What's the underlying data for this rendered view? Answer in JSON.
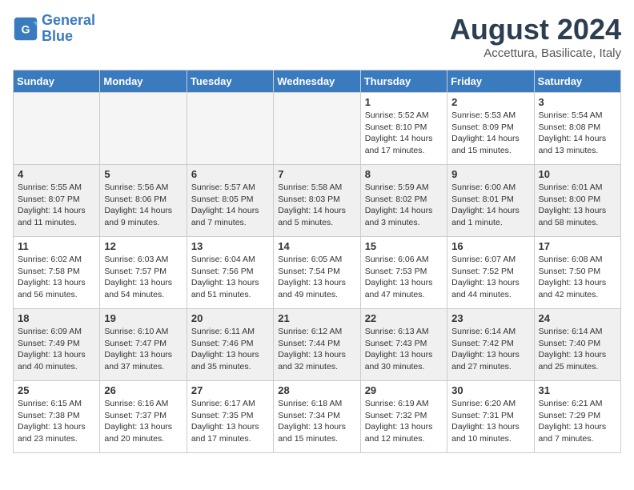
{
  "header": {
    "logo_line1": "General",
    "logo_line2": "Blue",
    "month_year": "August 2024",
    "location": "Accettura, Basilicate, Italy"
  },
  "weekdays": [
    "Sunday",
    "Monday",
    "Tuesday",
    "Wednesday",
    "Thursday",
    "Friday",
    "Saturday"
  ],
  "weeks": [
    [
      {
        "day": "",
        "info": ""
      },
      {
        "day": "",
        "info": ""
      },
      {
        "day": "",
        "info": ""
      },
      {
        "day": "",
        "info": ""
      },
      {
        "day": "1",
        "info": "Sunrise: 5:52 AM\nSunset: 8:10 PM\nDaylight: 14 hours\nand 17 minutes."
      },
      {
        "day": "2",
        "info": "Sunrise: 5:53 AM\nSunset: 8:09 PM\nDaylight: 14 hours\nand 15 minutes."
      },
      {
        "day": "3",
        "info": "Sunrise: 5:54 AM\nSunset: 8:08 PM\nDaylight: 14 hours\nand 13 minutes."
      }
    ],
    [
      {
        "day": "4",
        "info": "Sunrise: 5:55 AM\nSunset: 8:07 PM\nDaylight: 14 hours\nand 11 minutes."
      },
      {
        "day": "5",
        "info": "Sunrise: 5:56 AM\nSunset: 8:06 PM\nDaylight: 14 hours\nand 9 minutes."
      },
      {
        "day": "6",
        "info": "Sunrise: 5:57 AM\nSunset: 8:05 PM\nDaylight: 14 hours\nand 7 minutes."
      },
      {
        "day": "7",
        "info": "Sunrise: 5:58 AM\nSunset: 8:03 PM\nDaylight: 14 hours\nand 5 minutes."
      },
      {
        "day": "8",
        "info": "Sunrise: 5:59 AM\nSunset: 8:02 PM\nDaylight: 14 hours\nand 3 minutes."
      },
      {
        "day": "9",
        "info": "Sunrise: 6:00 AM\nSunset: 8:01 PM\nDaylight: 14 hours\nand 1 minute."
      },
      {
        "day": "10",
        "info": "Sunrise: 6:01 AM\nSunset: 8:00 PM\nDaylight: 13 hours\nand 58 minutes."
      }
    ],
    [
      {
        "day": "11",
        "info": "Sunrise: 6:02 AM\nSunset: 7:58 PM\nDaylight: 13 hours\nand 56 minutes."
      },
      {
        "day": "12",
        "info": "Sunrise: 6:03 AM\nSunset: 7:57 PM\nDaylight: 13 hours\nand 54 minutes."
      },
      {
        "day": "13",
        "info": "Sunrise: 6:04 AM\nSunset: 7:56 PM\nDaylight: 13 hours\nand 51 minutes."
      },
      {
        "day": "14",
        "info": "Sunrise: 6:05 AM\nSunset: 7:54 PM\nDaylight: 13 hours\nand 49 minutes."
      },
      {
        "day": "15",
        "info": "Sunrise: 6:06 AM\nSunset: 7:53 PM\nDaylight: 13 hours\nand 47 minutes."
      },
      {
        "day": "16",
        "info": "Sunrise: 6:07 AM\nSunset: 7:52 PM\nDaylight: 13 hours\nand 44 minutes."
      },
      {
        "day": "17",
        "info": "Sunrise: 6:08 AM\nSunset: 7:50 PM\nDaylight: 13 hours\nand 42 minutes."
      }
    ],
    [
      {
        "day": "18",
        "info": "Sunrise: 6:09 AM\nSunset: 7:49 PM\nDaylight: 13 hours\nand 40 minutes."
      },
      {
        "day": "19",
        "info": "Sunrise: 6:10 AM\nSunset: 7:47 PM\nDaylight: 13 hours\nand 37 minutes."
      },
      {
        "day": "20",
        "info": "Sunrise: 6:11 AM\nSunset: 7:46 PM\nDaylight: 13 hours\nand 35 minutes."
      },
      {
        "day": "21",
        "info": "Sunrise: 6:12 AM\nSunset: 7:44 PM\nDaylight: 13 hours\nand 32 minutes."
      },
      {
        "day": "22",
        "info": "Sunrise: 6:13 AM\nSunset: 7:43 PM\nDaylight: 13 hours\nand 30 minutes."
      },
      {
        "day": "23",
        "info": "Sunrise: 6:14 AM\nSunset: 7:42 PM\nDaylight: 13 hours\nand 27 minutes."
      },
      {
        "day": "24",
        "info": "Sunrise: 6:14 AM\nSunset: 7:40 PM\nDaylight: 13 hours\nand 25 minutes."
      }
    ],
    [
      {
        "day": "25",
        "info": "Sunrise: 6:15 AM\nSunset: 7:38 PM\nDaylight: 13 hours\nand 23 minutes."
      },
      {
        "day": "26",
        "info": "Sunrise: 6:16 AM\nSunset: 7:37 PM\nDaylight: 13 hours\nand 20 minutes."
      },
      {
        "day": "27",
        "info": "Sunrise: 6:17 AM\nSunset: 7:35 PM\nDaylight: 13 hours\nand 17 minutes."
      },
      {
        "day": "28",
        "info": "Sunrise: 6:18 AM\nSunset: 7:34 PM\nDaylight: 13 hours\nand 15 minutes."
      },
      {
        "day": "29",
        "info": "Sunrise: 6:19 AM\nSunset: 7:32 PM\nDaylight: 13 hours\nand 12 minutes."
      },
      {
        "day": "30",
        "info": "Sunrise: 6:20 AM\nSunset: 7:31 PM\nDaylight: 13 hours\nand 10 minutes."
      },
      {
        "day": "31",
        "info": "Sunrise: 6:21 AM\nSunset: 7:29 PM\nDaylight: 13 hours\nand 7 minutes."
      }
    ]
  ]
}
